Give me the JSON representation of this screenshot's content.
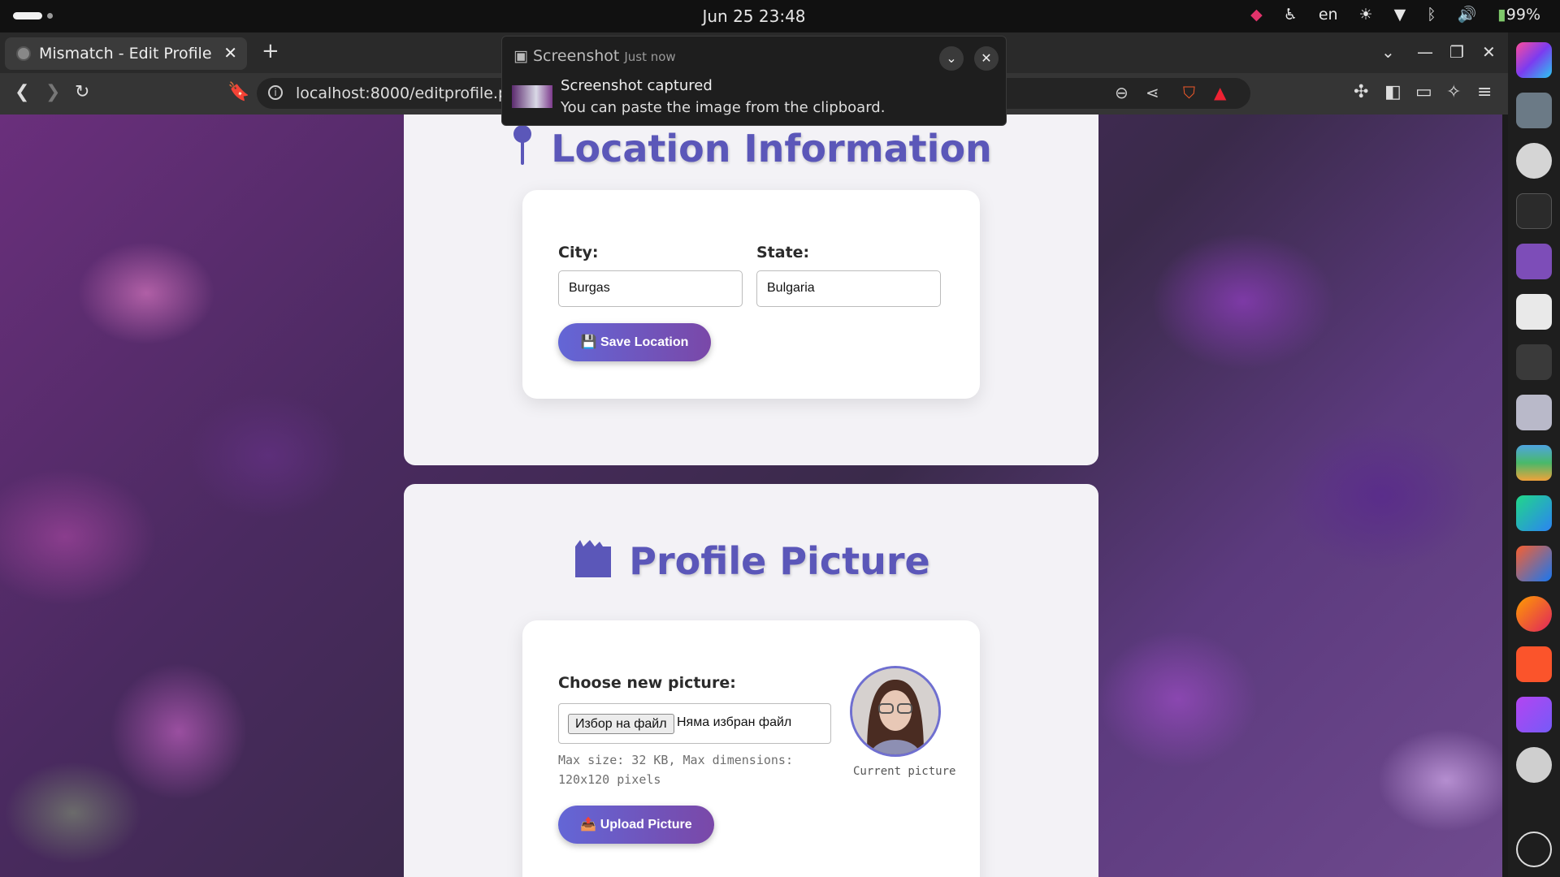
{
  "system": {
    "clock": "Jun 25  23:48",
    "language": "en",
    "battery": "99%"
  },
  "browser": {
    "tab_title": "Mismatch - Edit Profile",
    "url": "localhost:8000/editprofile.php"
  },
  "notification": {
    "app": "Screenshot",
    "time": "Just now",
    "title": "Screenshot captured",
    "body": "You can paste the image from the clipboard."
  },
  "location": {
    "heading": "Location Information",
    "city_label": "City:",
    "city_value": "Burgas",
    "state_label": "State:",
    "state_value": "Bulgaria",
    "save_label": "💾 Save Location"
  },
  "picture": {
    "heading": "Profile Picture",
    "choose_label": "Choose new picture:",
    "file_button": "Избор на файл",
    "file_status": "Няма избран файл",
    "hint": "Max size: 32 KB, Max dimensions: 120x120 pixels",
    "current_caption": "Current picture",
    "upload_label": "📤 Upload Picture"
  },
  "colors": {
    "heading": "#5b57b9",
    "button_start": "#6366d6",
    "button_end": "#7a48a8"
  },
  "dock_icons": [
    "pycharm-colorful-icon",
    "chess-knight-avatar-icon",
    "gear-wheel-icon",
    "system-monitor-icon",
    "purple-app-icon",
    "document-viewer-icon",
    "terminal-icon",
    "files-icon",
    "layers-icon",
    "pycharm-icon",
    "intellij-icon",
    "firefox-icon",
    "brave-icon",
    "phpstorm-icon",
    "settings-icon",
    "apps-grid-icon"
  ]
}
